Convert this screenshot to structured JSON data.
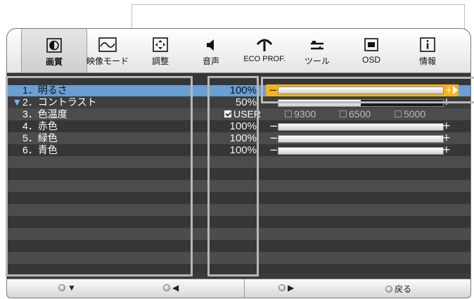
{
  "tabs": [
    {
      "label": "画質",
      "icon": "contrast-half-circle-icon",
      "active": true
    },
    {
      "label": "映像モード",
      "icon": "waveform-icon",
      "active": false
    },
    {
      "label": "調整",
      "icon": "position-arrows-icon",
      "active": false
    },
    {
      "label": "音声",
      "icon": "speaker-icon",
      "active": false
    },
    {
      "label": "ECO PROF.",
      "icon": "eco-leaf-icon",
      "active": false
    },
    {
      "label": "ツール",
      "icon": "tool-sliders-icon",
      "active": false
    },
    {
      "label": "OSD",
      "icon": "osd-window-icon",
      "active": false
    },
    {
      "label": "情報",
      "icon": "info-icon",
      "active": false
    }
  ],
  "menu": [
    {
      "label": "1．明るさ",
      "value": "100%",
      "level": 1.0,
      "selected": true
    },
    {
      "label": "2．コントラスト",
      "value": "50%",
      "level": 0.5,
      "expanded": true
    },
    {
      "label": "3．色温度",
      "value": "",
      "color_temp_options": [
        "USER",
        "9300",
        "6500",
        "5000"
      ],
      "color_temp_selected": "USER"
    },
    {
      "label": "4．赤色",
      "value": "100%",
      "level": 1.0
    },
    {
      "label": "5．緑色",
      "value": "100%",
      "level": 1.0
    },
    {
      "label": "6．青色",
      "value": "100%",
      "level": 1.0
    }
  ],
  "footer": {
    "down_icon": "▼",
    "left_icon": "◀",
    "right_icon": "▶",
    "back_label": "戻る"
  },
  "colors": {
    "selected_row": "#6a9fd4",
    "slider_highlight": "#f5b31c",
    "arrow_blue": "#6fb3ff"
  }
}
